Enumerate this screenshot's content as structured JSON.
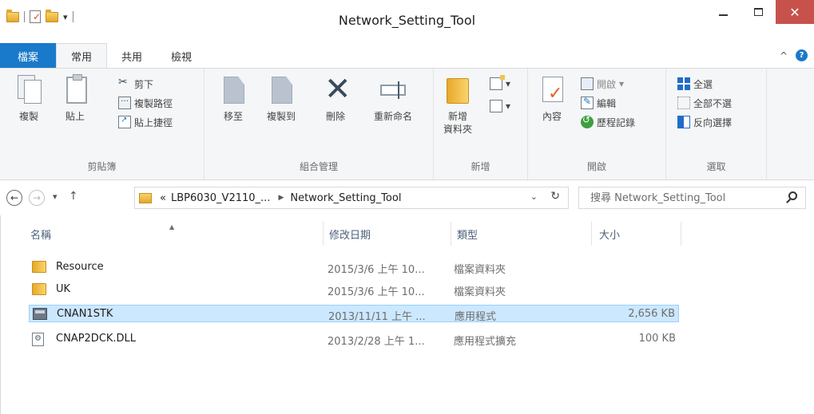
{
  "window": {
    "title": "Network_Setting_Tool"
  },
  "ribbon_tabs": [
    "檔案",
    "常用",
    "共用",
    "檢視"
  ],
  "ribbon": {
    "clipboard": {
      "label": "剪貼簿",
      "copy": "複製",
      "paste": "貼上",
      "cut": "剪下",
      "copy_path": "複製路徑",
      "paste_shortcut": "貼上捷徑"
    },
    "organize": {
      "label": "組合管理",
      "move_to": "移至",
      "copy_to": "複製到",
      "delete": "刪除",
      "rename": "重新命名"
    },
    "new": {
      "label": "新增",
      "new_folder_line1": "新增",
      "new_folder_line2": "資料夾"
    },
    "open": {
      "label": "開啟",
      "properties": "內容",
      "open": "開啟",
      "edit": "編輯",
      "history": "歷程記錄"
    },
    "select": {
      "label": "選取",
      "select_all": "全選",
      "select_none": "全部不選",
      "invert": "反向選擇"
    }
  },
  "address": {
    "prefix": "«",
    "parent": "LBP6030_V2110_...",
    "current": "Network_Setting_Tool"
  },
  "search": {
    "placeholder": "搜尋 Network_Setting_Tool"
  },
  "columns": {
    "name": "名稱",
    "date": "修改日期",
    "type": "類型",
    "size": "大小"
  },
  "files": [
    {
      "name": "Resource",
      "date": "2015/3/6 上午 10...",
      "type": "檔案資料夾",
      "size": "",
      "icon": "folder-icon"
    },
    {
      "name": "UK",
      "date": "2015/3/6 上午 10...",
      "type": "檔案資料夾",
      "size": "",
      "icon": "folder-icon"
    },
    {
      "name": "CNAN1STK",
      "date": "2013/11/11 上午 ...",
      "type": "應用程式",
      "size": "2,656 KB",
      "icon": "application-icon",
      "selected": true
    },
    {
      "name": "CNAP2DCK.DLL",
      "date": "2013/2/28 上午 1...",
      "type": "應用程式擴充",
      "size": "100 KB",
      "icon": "dll-icon"
    }
  ],
  "colors": {
    "file_tab": "#1979ca",
    "selection": "#cce8ff",
    "close_button": "#c7514b",
    "ribbon_bg": "#f5f6f7"
  }
}
